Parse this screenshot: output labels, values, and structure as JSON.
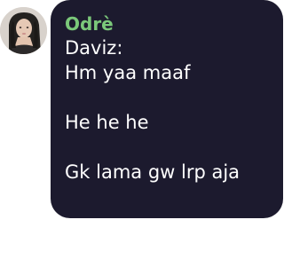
{
  "message": {
    "sender_name": "Odrè",
    "lines": [
      "Daviz:",
      "Hm yaa maaf",
      "",
      "He he he",
      "",
      "Gk lama gw lrp aja"
    ],
    "colors": {
      "bubble_bg": "#1c1a2e",
      "sender_color": "#7bc87a",
      "text_color": "#ffffff"
    }
  },
  "avatar": {
    "icon": "user-photo-avatar"
  }
}
